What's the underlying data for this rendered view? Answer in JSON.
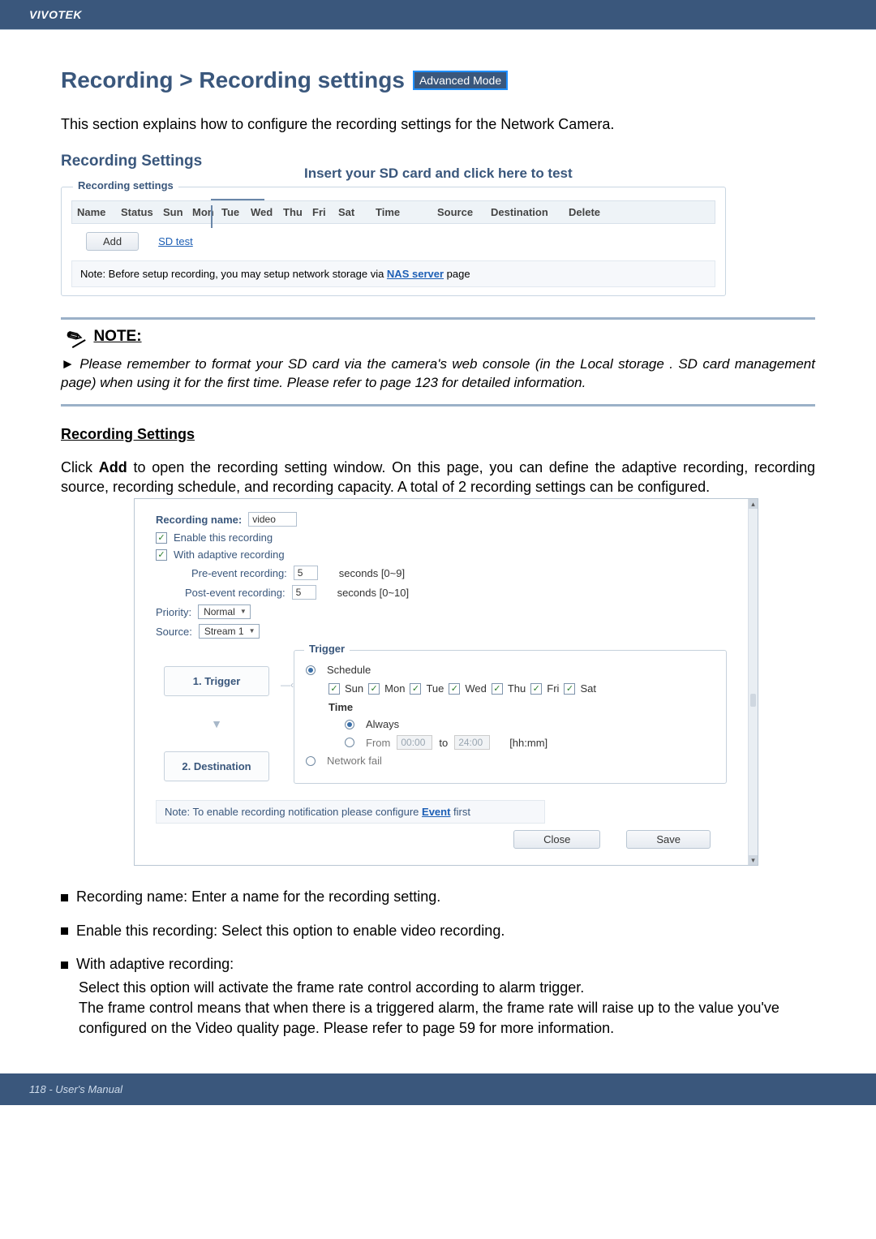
{
  "header": {
    "brand": "VIVOTEK"
  },
  "page": {
    "title": "Recording > Recording settings",
    "badge": "Advanced Mode",
    "intro": "This section explains how to configure the recording settings for the Network Camera."
  },
  "recSettings": {
    "heading": "Recording Settings",
    "insert_note": "Insert your SD card and click here to test",
    "legend": "Recording settings",
    "cols": [
      "Name",
      "Status",
      "Sun",
      "Mon",
      "Tue",
      "Wed",
      "Thu",
      "Fri",
      "Sat",
      "Time",
      "Source",
      "Destination",
      "Delete"
    ],
    "add_btn": "Add",
    "sd_link": "SD test",
    "storage_note_pre": "Note: Before setup recording, you may setup network storage via ",
    "storage_note_link": "NAS server",
    "storage_note_post": " page"
  },
  "noteBox": {
    "title": "NOTE:",
    "body": "► Please remember to format your SD card via the camera's web console (in the Local storage . SD card management page) when using it for the first time. Please refer to page 123 for detailed information."
  },
  "recSettings2": {
    "heading": "Recording Settings",
    "desc_pre": "Click ",
    "desc_bold": "Add",
    "desc_post": " to open the recording setting window. On this page, you can define the adaptive recording, recording source, recording schedule, and recording capacity. A total of 2 recording settings can be configured."
  },
  "dialog": {
    "name_label": "Recording name:",
    "name_value": "video",
    "enable_label": "Enable this recording",
    "adaptive_label": "With adaptive recording",
    "pre_label": "Pre-event recording:",
    "pre_value": "5",
    "pre_range": "seconds [0~9]",
    "post_label": "Post-event recording:",
    "post_value": "5",
    "post_range": "seconds [0~10]",
    "priority_label": "Priority:",
    "priority_value": "Normal",
    "source_label": "Source:",
    "source_value": "Stream 1",
    "step1": "1. Trigger",
    "step2": "2. Destination",
    "trigger_legend": "Trigger",
    "schedule_label": "Schedule",
    "days": [
      "Sun",
      "Mon",
      "Tue",
      "Wed",
      "Thu",
      "Fri",
      "Sat"
    ],
    "time_label": "Time",
    "always_label": "Always",
    "from_label": "From",
    "from_val": "00:00",
    "to_label": "to",
    "to_val": "24:00",
    "hhmm": "[hh:mm]",
    "netfail": "Network fail",
    "event_note_pre": "Note: To enable recording notification please configure ",
    "event_note_link": "Event",
    "event_note_post": " first",
    "close_btn": "Close",
    "save_btn": "Save"
  },
  "bullets": {
    "b1": "Recording name: Enter a name for the recording setting.",
    "b2": "Enable this recording: Select this option to enable video recording.",
    "b3_title": "With adaptive recording:",
    "b3_l1": "Select this option will activate the frame rate control according to alarm trigger.",
    "b3_l2": "The frame control means that when there is a triggered alarm, the frame rate will raise up to the value you've configured on the Video quality page. Please refer to page 59 for more information."
  },
  "footer": {
    "text": "118 - User's Manual"
  }
}
